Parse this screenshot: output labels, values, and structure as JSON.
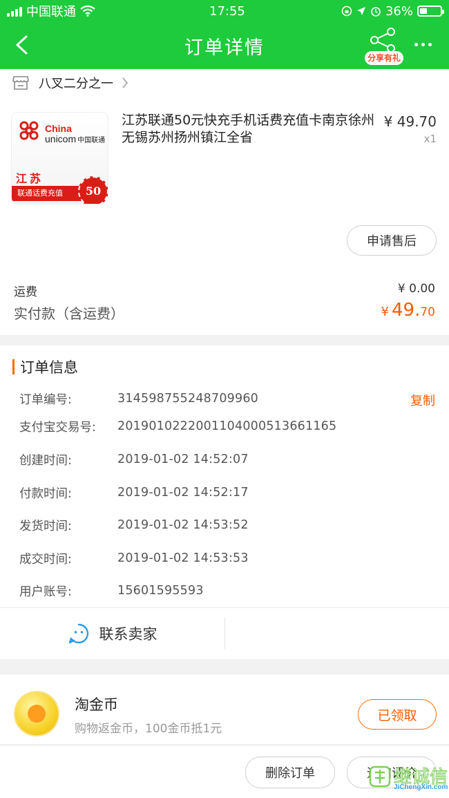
{
  "status_bar": {
    "carrier": "中国联通",
    "time": "17:55",
    "battery": "36%",
    "battery_level": 0.36
  },
  "header": {
    "title": "订单详情",
    "share_label": "分享有礼"
  },
  "shop": {
    "name": "八叉二分之一"
  },
  "product": {
    "title": "江苏联通50元快充手机话费充值卡南京徐州无锡苏州扬州镇江全省",
    "price": "¥ 49.70",
    "qty": "x1",
    "image": {
      "brand_en_1": "China",
      "brand_en_2": "unicom",
      "brand_cn": "中国联通",
      "province": "江苏",
      "ribbon": "联通话费充值",
      "seal": "50"
    }
  },
  "after_sale_button": "申请售后",
  "fees": {
    "shipping_label": "运费",
    "shipping_value": "¥ 0.00",
    "paid_label": "实付款（含运费）",
    "paid_currency": "¥",
    "paid_int": "49.",
    "paid_dec": "70"
  },
  "order_info": {
    "title": "订单信息",
    "copy_label": "复制",
    "rows": [
      {
        "k": "订单编号:",
        "v": "314598755248709960"
      },
      {
        "k": "支付宝交易号:",
        "v": "2019010222001104000513661165"
      },
      {
        "k": "创建时间:",
        "v": "2019-01-02 14:52:07"
      },
      {
        "k": "付款时间:",
        "v": "2019-01-02 14:52:17"
      },
      {
        "k": "发货时间:",
        "v": "2019-01-02 14:53:52"
      },
      {
        "k": "成交时间:",
        "v": "2019-01-02 14:53:53"
      },
      {
        "k": "用户账号:",
        "v": "15601595593"
      }
    ],
    "contact_label": "联系卖家"
  },
  "coins": {
    "title": "淘金币",
    "desc": "购物返金币，100金币抵1元",
    "button": "已领取"
  },
  "footer": {
    "delete_button": "删除订单",
    "review_button": "追加评价"
  },
  "watermark": {
    "text": "JiChengXin.com",
    "cn": "继诚信"
  },
  "colors": {
    "brand_green": "#1ecb3c",
    "accent_orange": "#ff5a00",
    "unicom_red": "#d91e18"
  }
}
